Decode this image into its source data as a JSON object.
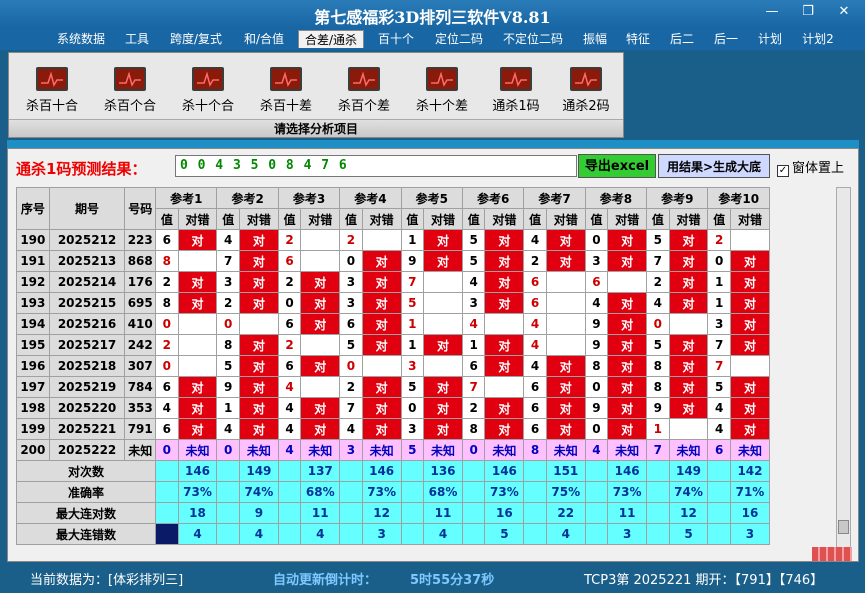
{
  "window": {
    "title": "第七感福彩3D排列三软件V8.81"
  },
  "menu": [
    "系统数据",
    "工具",
    "跨度/复式",
    "和/合值",
    "合差/通杀",
    "百十个",
    "定位二码",
    "不定位二码",
    "振幅",
    "特征",
    "后二",
    "后一",
    "计划",
    "计划2"
  ],
  "ribbon": {
    "buttons": [
      "杀百十合",
      "杀百个合",
      "杀十个合",
      "杀百十差",
      "杀百个差",
      "杀十个差",
      "通杀1码",
      "通杀2码"
    ],
    "caption": "请选择分析项目"
  },
  "prediction": {
    "label": "通杀1码预测结果：",
    "value": "0 0 4 3 5 0 8 4 7 6",
    "export_label": "导出excel",
    "generate_label": "用结果>生成大底",
    "checkbox_label": "窗体置上",
    "checkbox_mark": "✓"
  },
  "table": {
    "headers": {
      "seq": "序号",
      "period": "期号",
      "number": "号码"
    },
    "ref_headers": [
      "参考1",
      "参考2",
      "参考3",
      "参考4",
      "参考5",
      "参考6",
      "参考7",
      "参考8",
      "参考9",
      "参考10"
    ],
    "sub_value": "值",
    "sub_result": "对错",
    "bad_mark": "对",
    "rows": [
      {
        "seq": "190",
        "period": "2025212",
        "number": "223",
        "vals": [
          "6",
          "4",
          "2",
          "2",
          "1",
          "5",
          "4",
          "0",
          "5",
          "2"
        ],
        "res": [
          1,
          1,
          0,
          0,
          1,
          1,
          1,
          1,
          1,
          0
        ]
      },
      {
        "seq": "191",
        "period": "2025213",
        "number": "868",
        "vals": [
          "8",
          "7",
          "6",
          "0",
          "9",
          "5",
          "2",
          "3",
          "7",
          "0"
        ],
        "res": [
          0,
          1,
          0,
          1,
          1,
          1,
          1,
          1,
          1,
          1
        ]
      },
      {
        "seq": "192",
        "period": "2025214",
        "number": "176",
        "vals": [
          "2",
          "3",
          "2",
          "3",
          "7",
          "4",
          "6",
          "6",
          "2",
          "1"
        ],
        "res": [
          1,
          1,
          1,
          1,
          0,
          1,
          0,
          0,
          1,
          1
        ]
      },
      {
        "seq": "193",
        "period": "2025215",
        "number": "695",
        "vals": [
          "8",
          "2",
          "0",
          "3",
          "5",
          "3",
          "6",
          "4",
          "4",
          "1"
        ],
        "res": [
          1,
          1,
          1,
          1,
          0,
          1,
          0,
          1,
          1,
          1
        ]
      },
      {
        "seq": "194",
        "period": "2025216",
        "number": "410",
        "vals": [
          "0",
          "0",
          "6",
          "6",
          "1",
          "4",
          "4",
          "9",
          "0",
          "3"
        ],
        "res": [
          0,
          0,
          1,
          1,
          0,
          0,
          0,
          1,
          0,
          1
        ]
      },
      {
        "seq": "195",
        "period": "2025217",
        "number": "242",
        "vals": [
          "2",
          "8",
          "2",
          "5",
          "1",
          "1",
          "4",
          "9",
          "5",
          "7"
        ],
        "res": [
          0,
          1,
          0,
          1,
          1,
          1,
          0,
          1,
          1,
          1
        ]
      },
      {
        "seq": "196",
        "period": "2025218",
        "number": "307",
        "vals": [
          "0",
          "5",
          "6",
          "0",
          "3",
          "6",
          "4",
          "8",
          "8",
          "7"
        ],
        "res": [
          0,
          1,
          1,
          0,
          0,
          1,
          1,
          1,
          1,
          0
        ]
      },
      {
        "seq": "197",
        "period": "2025219",
        "number": "784",
        "vals": [
          "6",
          "9",
          "4",
          "2",
          "5",
          "7",
          "6",
          "0",
          "8",
          "5"
        ],
        "res": [
          1,
          1,
          0,
          1,
          1,
          0,
          1,
          1,
          1,
          1
        ]
      },
      {
        "seq": "198",
        "period": "2025220",
        "number": "353",
        "vals": [
          "4",
          "1",
          "4",
          "7",
          "0",
          "2",
          "6",
          "9",
          "9",
          "4"
        ],
        "res": [
          1,
          1,
          1,
          1,
          1,
          1,
          1,
          1,
          1,
          1
        ]
      },
      {
        "seq": "199",
        "period": "2025221",
        "number": "791",
        "vals": [
          "6",
          "4",
          "4",
          "4",
          "3",
          "8",
          "6",
          "0",
          "1",
          "4"
        ],
        "res": [
          1,
          1,
          1,
          1,
          1,
          1,
          1,
          1,
          0,
          1
        ]
      }
    ],
    "pred_row": {
      "seq": "200",
      "period": "2025222",
      "number": "未知",
      "vals": [
        "0",
        "0",
        "4",
        "3",
        "5",
        "0",
        "8",
        "4",
        "7",
        "6"
      ],
      "res_label": "未知"
    },
    "stats": [
      {
        "label": "对次数",
        "values": [
          "146",
          "149",
          "137",
          "146",
          "136",
          "146",
          "151",
          "146",
          "149",
          "142"
        ]
      },
      {
        "label": "准确率",
        "values": [
          "73%",
          "74%",
          "68%",
          "73%",
          "68%",
          "73%",
          "75%",
          "73%",
          "74%",
          "71%"
        ]
      },
      {
        "label": "最大连对数",
        "values": [
          "18",
          "9",
          "11",
          "12",
          "11",
          "16",
          "22",
          "11",
          "12",
          "16"
        ]
      },
      {
        "label": "最大连错数",
        "values": [
          "4",
          "4",
          "4",
          "3",
          "4",
          "5",
          "4",
          "3",
          "5",
          "3"
        ]
      }
    ]
  },
  "status": {
    "data_source": "当前数据为：[体彩排列三]",
    "countdown_label": "自动更新倒计时：",
    "countdown_value": "5时55分37秒",
    "period_info": "TCP3第 2025221 期开：【791】【746】"
  },
  "colors": {
    "bad": "#e00010",
    "stats": "#66ffff",
    "predict": "#ffc0ff",
    "accent": "#1866a4"
  }
}
